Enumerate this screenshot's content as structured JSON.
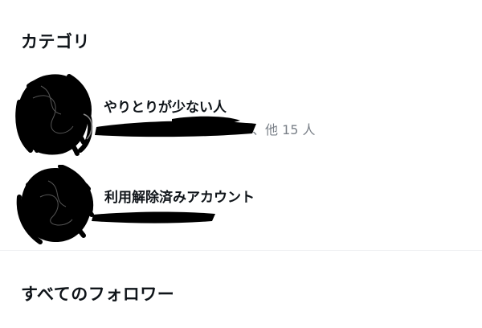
{
  "categories_section": {
    "title": "カテゴリ",
    "items": [
      {
        "label": "やりとりが少ない人",
        "subtitle": "、他 15 人"
      },
      {
        "label": "利用解除済みアカウント"
      }
    ]
  },
  "all_followers_section": {
    "title": "すべてのフォロワー"
  },
  "colors": {
    "text_primary": "#0f1419",
    "text_secondary": "#7a8088",
    "divider": "#eff1f3",
    "redaction": "#000000"
  }
}
